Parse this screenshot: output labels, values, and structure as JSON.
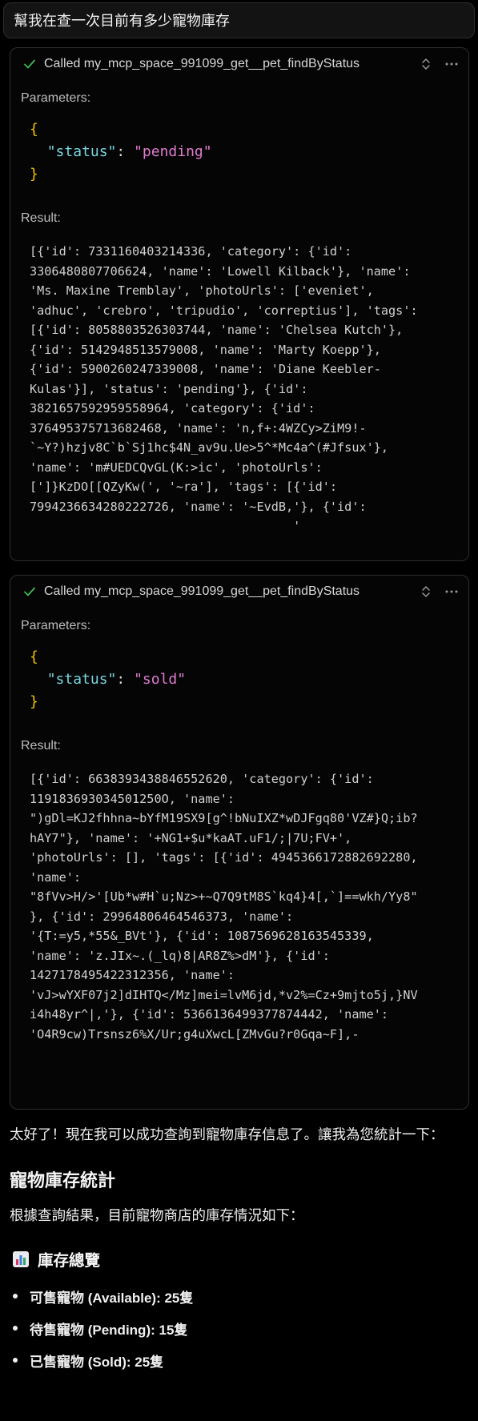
{
  "user_message": "幫我在查一次目前有多少寵物庫存",
  "tool_calls": [
    {
      "title": "Called my_mcp_space_991099_get__pet_findByStatus",
      "parameters_label": "Parameters:",
      "param_key": "\"status\"",
      "param_value": "\"pending\"",
      "result_label": "Result:",
      "result_lines": [
        "[{'id': 7331160403214336, 'category': {'id':",
        "3306480807706624, 'name': 'Lowell Kilback'}, 'name':",
        "'Ms. Maxine Tremblay', 'photoUrls': ['eveniet',",
        "'adhuc', 'crebro', 'tripudio', 'correptius'], 'tags':",
        "[{'id': 8058803526303744, 'name': 'Chelsea Kutch'},",
        "{'id': 5142948513579008, 'name': 'Marty Koepp'},",
        "{'id': 5900260247339008, 'name': 'Diane Keebler-",
        "Kulas'}], 'status': 'pending'}, {'id':",
        "3821657592959558964, 'category': {'id':",
        "376495375713682468, 'name': 'n,f+:4WZCy>ZiM9!-",
        "`~Y?)hzjv8C`b`Sj1hc$4N_av9u.Ue>5^*Mc4a^(#Jfsux'},",
        "'name': 'm#UEDCQvGL(K:>ic', 'photoUrls':",
        "[']}KzDO[[QZyKw(', '~ra'], 'tags': [{'id':",
        "7994236634280222726, 'name': '~EvdB,'}, {'id':",
        "                                    '"
      ]
    },
    {
      "title": "Called my_mcp_space_991099_get__pet_findByStatus",
      "parameters_label": "Parameters:",
      "param_key": "\"status\"",
      "param_value": "\"sold\"",
      "result_label": "Result:",
      "result_lines": [
        "[{'id': 6638393438846552620, 'category': {'id':",
        "119183693034501250O, 'name':",
        "\")gDl=KJ2fhhna~bYfM19SX9[g^!bNuIXZ*wDJFgq80'VZ#}Q;ib?",
        "hAY7\"}, 'name': '+NG1+$u*kaAT.uF1/;|7U;FV+',",
        "'photoUrls': [], 'tags': [{'id': 4945366172882692280,",
        "'name':",
        "\"8fVv>H/>'[Ub*w#H`u;Nz>+~Q7Q9tM8S`kq4}4[,`]==wkh/Yy8\"",
        "}, {'id': 29964806464546373, 'name':",
        "'{T:=y5,*55&_BVt'}, {'id': 1087569628163545339,",
        "'name': 'z.JIx~.(_lq)8|AR8Z%>dM'}, {'id':",
        "1427178495422312356, 'name':",
        "'vJ>wYXF07j2]dIHTQ</Mz]mei=lvM6jd,*v2%=Cz+9mjto5j,}NV",
        "i4h48yr^|,'}, {'id': 5366136499377874442, 'name':",
        "'O4R9cw)Trsnsz6%X/Ur;g4uXwcL[ZMvGu?r0Gqa~F],-"
      ]
    }
  ],
  "assistant": {
    "intro": "太好了！現在我可以成功查詢到寵物庫存信息了。讓我為您統計一下：",
    "heading": "寵物庫存統計",
    "summary": "根據查詢結果，目前寵物商店的庫存情況如下：",
    "subheading": "庫存總覽",
    "subheading_icon": "bar-chart-icon",
    "bullets": [
      {
        "label": "可售寵物 (Available): 25隻"
      },
      {
        "label": "待售寵物 (Pending): 15隻"
      },
      {
        "label": "已售寵物 (Sold): 25隻"
      }
    ]
  },
  "colors": {
    "check": "#3fb950",
    "brace": "#f2c200",
    "key": "#79d5e0",
    "string": "#e07ccf"
  }
}
